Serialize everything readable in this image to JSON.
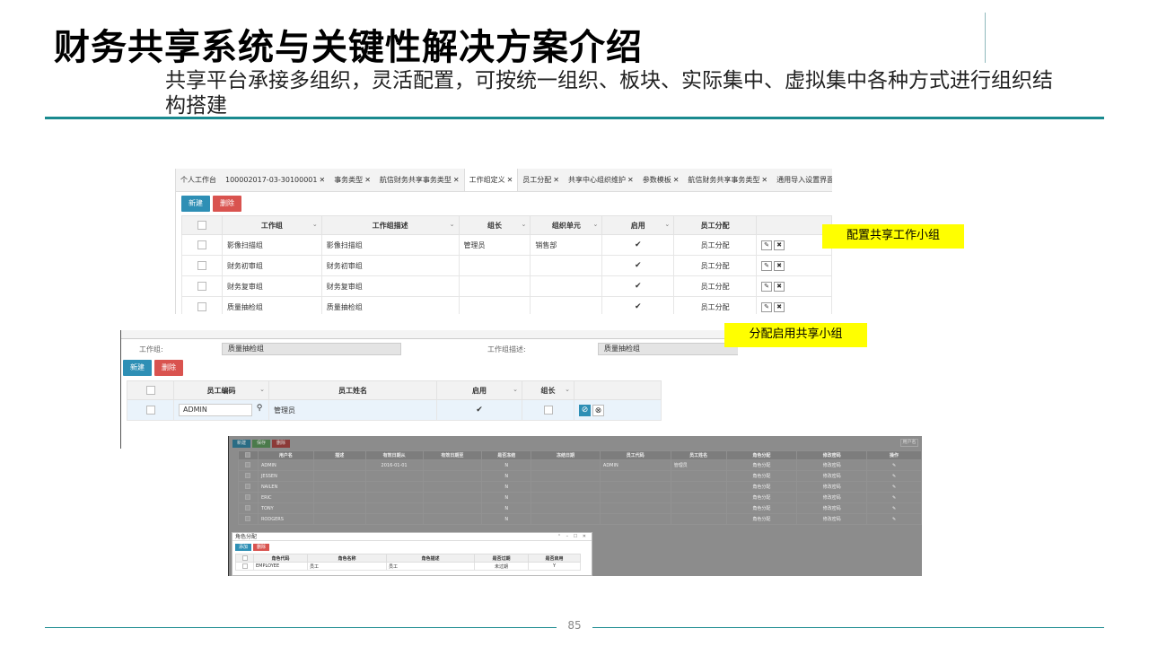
{
  "slide": {
    "title": "财务共享系统与关键性解决方案介绍",
    "subtitle": "共享平台承接多组织，灵活配置，可按统一组织、板块、实际集中、虚拟集中各种方式进行组织结构搭建",
    "page_number": "85",
    "accent_color": "#1a8a8f",
    "label1": "配置共享工作小组",
    "label2": "分配启用共享小组"
  },
  "shot1": {
    "tabs": [
      "个人工作台",
      "100002017-03-30100001",
      "事务类型",
      "航信财务共享事务类型",
      "工作组定义",
      "员工分配",
      "共享中心组织维护",
      "参数模板",
      "航信财务共享事务类型",
      "通用导入设置界面"
    ],
    "active_tab": 4,
    "new_label": "新建",
    "delete_label": "删除",
    "columns": [
      "工作组",
      "工作组描述",
      "组长",
      "组织单元",
      "启用",
      "员工分配"
    ],
    "rows": [
      {
        "group": "影像扫描组",
        "desc": "影像扫描组",
        "leader": "管理员",
        "org": "销售部",
        "enabled": "✔",
        "assign": "员工分配"
      },
      {
        "group": "财务初审组",
        "desc": "财务初审组",
        "leader": "",
        "org": "",
        "enabled": "✔",
        "assign": "员工分配"
      },
      {
        "group": "财务复审组",
        "desc": "财务复审组",
        "leader": "",
        "org": "",
        "enabled": "✔",
        "assign": "员工分配"
      },
      {
        "group": "质量抽检组",
        "desc": "质量抽检组",
        "leader": "",
        "org": "",
        "enabled": "✔",
        "assign": "员工分配"
      }
    ]
  },
  "shot2": {
    "group_label": "工作组:",
    "group_value": "质量抽检组",
    "desc_label": "工作组描述:",
    "desc_value": "质量抽检组",
    "new_label": "新建",
    "delete_label": "删除",
    "columns": [
      "员工编码",
      "员工姓名",
      "启用",
      "组长"
    ],
    "row": {
      "code": "ADMIN",
      "name": "管理员",
      "enabled": "✔"
    }
  },
  "shot3": {
    "buttons": [
      "新建",
      "保存",
      "删除"
    ],
    "search_label": "用户名",
    "columns": [
      "用户名",
      "描述",
      "有效日期从",
      "有效日期至",
      "是否冻结",
      "冻结日期",
      "员工代码",
      "员工姓名",
      "角色分配",
      "修改密码",
      "操作"
    ],
    "rows": [
      {
        "user": "ADMIN",
        "from": "2016-01-01",
        "frozen": "N",
        "emp_code": "ADMIN",
        "emp_name": "管理员"
      },
      {
        "user": "JESSEN",
        "from": "",
        "frozen": "N",
        "emp_code": "",
        "emp_name": ""
      },
      {
        "user": "NAILEN",
        "from": "",
        "frozen": "N",
        "emp_code": "",
        "emp_name": ""
      },
      {
        "user": "ERIC",
        "from": "",
        "frozen": "N",
        "emp_code": "",
        "emp_name": ""
      },
      {
        "user": "TONY",
        "from": "",
        "frozen": "N",
        "emp_code": "",
        "emp_name": ""
      },
      {
        "user": "RODGERS",
        "from": "",
        "frozen": "N",
        "emp_code": "",
        "emp_name": ""
      }
    ],
    "role_link": "角色分配",
    "pwd_link": "修改密码",
    "dialog": {
      "title": "角色分配",
      "add_label": "添加",
      "delete_label": "删除",
      "columns": [
        "角色代码",
        "角色名称",
        "角色描述",
        "是否过期",
        "是否启用"
      ],
      "row": {
        "code": "EMPLOYEE",
        "name": "员工",
        "desc": "员工",
        "expired": "未过期",
        "enabled": "Y"
      }
    }
  }
}
